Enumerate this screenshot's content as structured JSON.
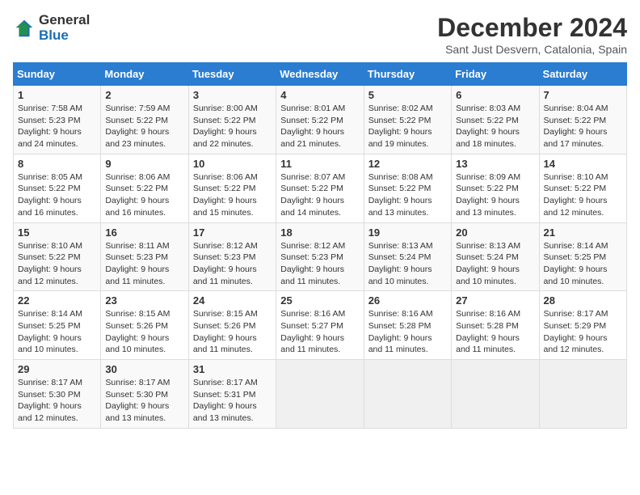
{
  "logo": {
    "general": "General",
    "blue": "Blue"
  },
  "header": {
    "title": "December 2024",
    "subtitle": "Sant Just Desvern, Catalonia, Spain"
  },
  "calendar": {
    "days_of_week": [
      "Sunday",
      "Monday",
      "Tuesday",
      "Wednesday",
      "Thursday",
      "Friday",
      "Saturday"
    ],
    "weeks": [
      [
        null,
        null,
        null,
        null,
        null,
        null,
        null
      ]
    ],
    "cells": [
      {
        "day": "1",
        "sunrise": "7:58 AM",
        "sunset": "5:23 PM",
        "daylight": "9 hours and 24 minutes."
      },
      {
        "day": "2",
        "sunrise": "7:59 AM",
        "sunset": "5:22 PM",
        "daylight": "9 hours and 23 minutes."
      },
      {
        "day": "3",
        "sunrise": "8:00 AM",
        "sunset": "5:22 PM",
        "daylight": "9 hours and 22 minutes."
      },
      {
        "day": "4",
        "sunrise": "8:01 AM",
        "sunset": "5:22 PM",
        "daylight": "9 hours and 21 minutes."
      },
      {
        "day": "5",
        "sunrise": "8:02 AM",
        "sunset": "5:22 PM",
        "daylight": "9 hours and 19 minutes."
      },
      {
        "day": "6",
        "sunrise": "8:03 AM",
        "sunset": "5:22 PM",
        "daylight": "9 hours and 18 minutes."
      },
      {
        "day": "7",
        "sunrise": "8:04 AM",
        "sunset": "5:22 PM",
        "daylight": "9 hours and 17 minutes."
      },
      {
        "day": "8",
        "sunrise": "8:05 AM",
        "sunset": "5:22 PM",
        "daylight": "9 hours and 16 minutes."
      },
      {
        "day": "9",
        "sunrise": "8:06 AM",
        "sunset": "5:22 PM",
        "daylight": "9 hours and 16 minutes."
      },
      {
        "day": "10",
        "sunrise": "8:06 AM",
        "sunset": "5:22 PM",
        "daylight": "9 hours and 15 minutes."
      },
      {
        "day": "11",
        "sunrise": "8:07 AM",
        "sunset": "5:22 PM",
        "daylight": "9 hours and 14 minutes."
      },
      {
        "day": "12",
        "sunrise": "8:08 AM",
        "sunset": "5:22 PM",
        "daylight": "9 hours and 13 minutes."
      },
      {
        "day": "13",
        "sunrise": "8:09 AM",
        "sunset": "5:22 PM",
        "daylight": "9 hours and 13 minutes."
      },
      {
        "day": "14",
        "sunrise": "8:10 AM",
        "sunset": "5:22 PM",
        "daylight": "9 hours and 12 minutes."
      },
      {
        "day": "15",
        "sunrise": "8:10 AM",
        "sunset": "5:22 PM",
        "daylight": "9 hours and 12 minutes."
      },
      {
        "day": "16",
        "sunrise": "8:11 AM",
        "sunset": "5:23 PM",
        "daylight": "9 hours and 11 minutes."
      },
      {
        "day": "17",
        "sunrise": "8:12 AM",
        "sunset": "5:23 PM",
        "daylight": "9 hours and 11 minutes."
      },
      {
        "day": "18",
        "sunrise": "8:12 AM",
        "sunset": "5:23 PM",
        "daylight": "9 hours and 11 minutes."
      },
      {
        "day": "19",
        "sunrise": "8:13 AM",
        "sunset": "5:24 PM",
        "daylight": "9 hours and 10 minutes."
      },
      {
        "day": "20",
        "sunrise": "8:13 AM",
        "sunset": "5:24 PM",
        "daylight": "9 hours and 10 minutes."
      },
      {
        "day": "21",
        "sunrise": "8:14 AM",
        "sunset": "5:25 PM",
        "daylight": "9 hours and 10 minutes."
      },
      {
        "day": "22",
        "sunrise": "8:14 AM",
        "sunset": "5:25 PM",
        "daylight": "9 hours and 10 minutes."
      },
      {
        "day": "23",
        "sunrise": "8:15 AM",
        "sunset": "5:26 PM",
        "daylight": "9 hours and 10 minutes."
      },
      {
        "day": "24",
        "sunrise": "8:15 AM",
        "sunset": "5:26 PM",
        "daylight": "9 hours and 11 minutes."
      },
      {
        "day": "25",
        "sunrise": "8:16 AM",
        "sunset": "5:27 PM",
        "daylight": "9 hours and 11 minutes."
      },
      {
        "day": "26",
        "sunrise": "8:16 AM",
        "sunset": "5:28 PM",
        "daylight": "9 hours and 11 minutes."
      },
      {
        "day": "27",
        "sunrise": "8:16 AM",
        "sunset": "5:28 PM",
        "daylight": "9 hours and 11 minutes."
      },
      {
        "day": "28",
        "sunrise": "8:17 AM",
        "sunset": "5:29 PM",
        "daylight": "9 hours and 12 minutes."
      },
      {
        "day": "29",
        "sunrise": "8:17 AM",
        "sunset": "5:30 PM",
        "daylight": "9 hours and 12 minutes."
      },
      {
        "day": "30",
        "sunrise": "8:17 AM",
        "sunset": "5:30 PM",
        "daylight": "9 hours and 13 minutes."
      },
      {
        "day": "31",
        "sunrise": "8:17 AM",
        "sunset": "5:31 PM",
        "daylight": "9 hours and 13 minutes."
      }
    ],
    "labels": {
      "sunrise": "Sunrise:",
      "sunset": "Sunset:",
      "daylight": "Daylight:"
    }
  }
}
